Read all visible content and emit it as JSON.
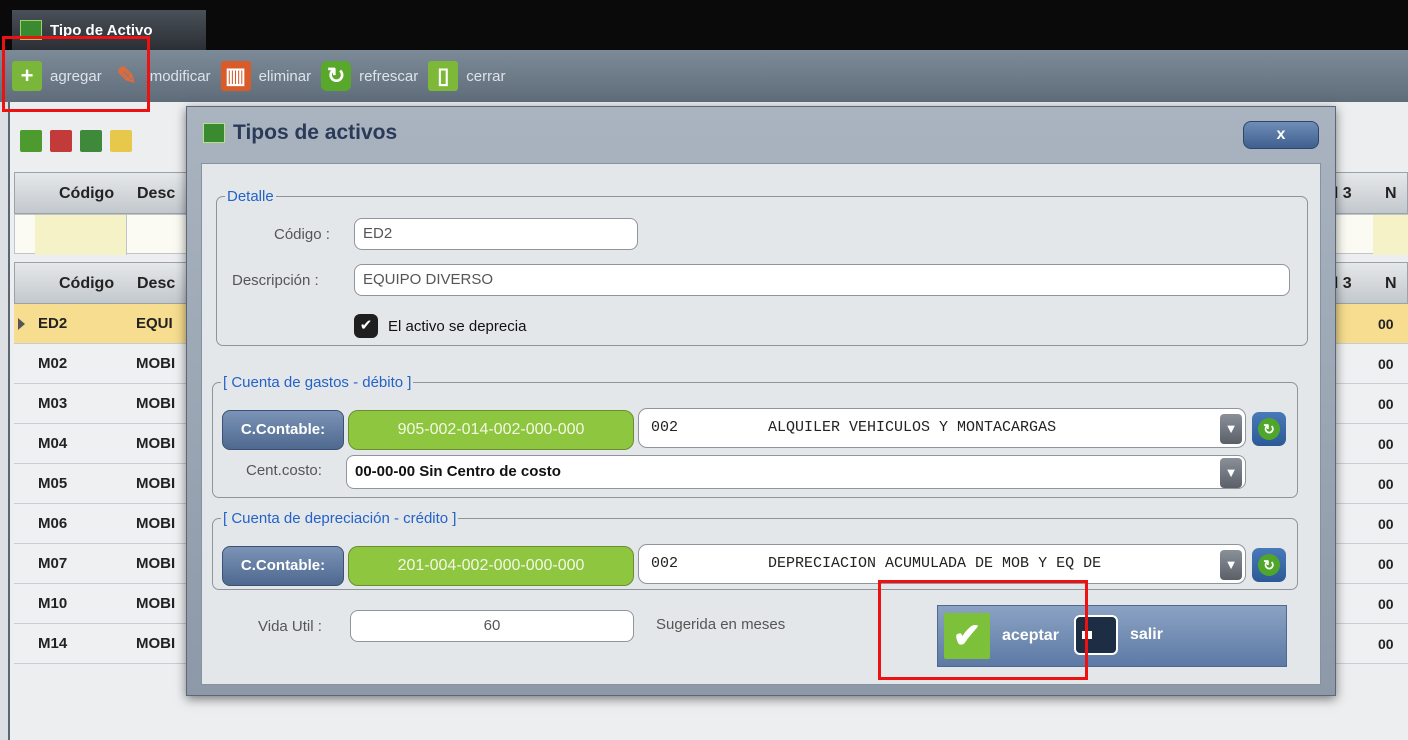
{
  "window": {
    "tab_title": "Tipo de Activo"
  },
  "toolbar": {
    "add_label": "agregar",
    "edit_label": "modificar",
    "delete_label": "eliminar",
    "refresh_label": "refrescar",
    "close_label": "cerrar"
  },
  "grid": {
    "header": {
      "codigo": "Código",
      "desc": "Desc",
      "nivel3": "el 3",
      "n": "N"
    },
    "rows": [
      {
        "codigo": "ED2",
        "desc": "EQUI",
        "n": "00"
      },
      {
        "codigo": "M02",
        "desc": "MOBI",
        "n": "00"
      },
      {
        "codigo": "M03",
        "desc": "MOBI",
        "n": "00"
      },
      {
        "codigo": "M04",
        "desc": "MOBI",
        "n": "00"
      },
      {
        "codigo": "M05",
        "desc": "MOBI",
        "n": "00"
      },
      {
        "codigo": "M06",
        "desc": "MOBI",
        "n": "00"
      },
      {
        "codigo": "M07",
        "desc": "MOBI",
        "n": "00"
      },
      {
        "codigo": "M10",
        "desc": "MOBI",
        "n": "00"
      },
      {
        "codigo": "M14",
        "desc": "MOBI",
        "n": "00"
      }
    ]
  },
  "dialog": {
    "title": "Tipos de activos",
    "close": "x",
    "detalle": {
      "legend": "Detalle",
      "codigo_label": "Código :",
      "codigo_value": "ED2",
      "descripcion_label": "Descripción :",
      "descripcion_value": "EQUIPO DIVERSO",
      "deprecia_label": "El activo se deprecia",
      "deprecia_checked": true
    },
    "gastos": {
      "legend": "[ Cuenta de gastos - débito ]",
      "btn_label": "C.Contable:",
      "account": "905-002-014-002-000-000",
      "combo_text": "002          ALQUILER VEHICULOS Y MONTACARGAS",
      "cc_label": "Cent.costo:",
      "cc_value": "00-00-00 Sin Centro de costo"
    },
    "depreciacion": {
      "legend": "[ Cuenta de depreciación - crédito ]",
      "btn_label": "C.Contable:",
      "account": "201-004-002-000-000-000",
      "combo_text": "002          DEPRECIACION ACUMULADA DE MOB Y EQ DE"
    },
    "vida_label": "Vida Util :",
    "vida_value": "60",
    "vida_hint": "Sugerida en meses",
    "accept_label": "aceptar",
    "exit_label": "salir"
  },
  "colors": {
    "accent_green": "#8ec63f",
    "highlight_red": "#ee1111",
    "selected_row": "#f6dd8f"
  }
}
